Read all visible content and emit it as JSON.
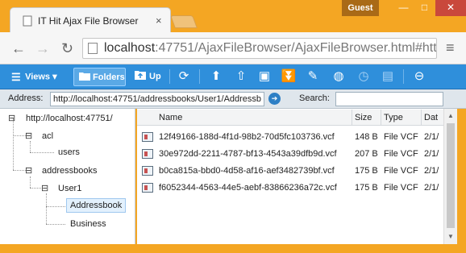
{
  "window": {
    "tab_title": "IT Hit Ajax File Browser",
    "tab_close": "×",
    "profile": "Guest",
    "min": "—",
    "max": "□",
    "close": "✕"
  },
  "navbar": {
    "back": "←",
    "forward": "→",
    "reload": "↻",
    "url_host": "localhost",
    "url_rest": ":47751/AjaxFileBrowser/AjaxFileBrowser.html#htt",
    "menu": "≡"
  },
  "toolbar": {
    "views_label": "Views",
    "views_icon": "☰",
    "views_caret": "▾",
    "folders_label": "Folders",
    "up_label": "Up",
    "icons": [
      "refresh-icon",
      "upload-icon",
      "upload-cloud-icon",
      "new-folder-icon",
      "download-icon",
      "edit-icon",
      "globe-icon",
      "history-icon",
      "properties-icon",
      "delete-icon"
    ]
  },
  "address": {
    "label": "Address:",
    "value": "http://localhost:47751/addressbooks/User1/Addressb",
    "go": "➔",
    "search_label": "Search:",
    "search_value": ""
  },
  "tree": {
    "root": "http://localhost:47751/",
    "acl": "acl",
    "users": "users",
    "addressbooks": "addressbooks",
    "user1": "User1",
    "addressbook": "Addressbook",
    "business": "Business",
    "minus": "⊟"
  },
  "list": {
    "columns": [
      "Name",
      "Size",
      "Type",
      "Dat"
    ],
    "rows": [
      {
        "name": "12f49166-188d-4f1d-98b2-70d5fc103736.vcf",
        "size": "148 B",
        "type": "File VCF",
        "date": "2/1/"
      },
      {
        "name": "30e972dd-2211-4787-bf13-4543a39dfb9d.vcf",
        "size": "207 B",
        "type": "File VCF",
        "date": "2/1/"
      },
      {
        "name": "b0ca815a-bbd0-4d58-af16-aef3482739bf.vcf",
        "size": "175 B",
        "type": "File VCF",
        "date": "2/1/"
      },
      {
        "name": "f6052344-4563-44e5-aebf-83866236a72c.vcf",
        "size": "175 B",
        "type": "File VCF",
        "date": "2/1/"
      }
    ]
  },
  "colors": {
    "window_frame": "#f4a623",
    "toolbar_blue": "#2f8fdb",
    "close_red": "#c9483c"
  }
}
